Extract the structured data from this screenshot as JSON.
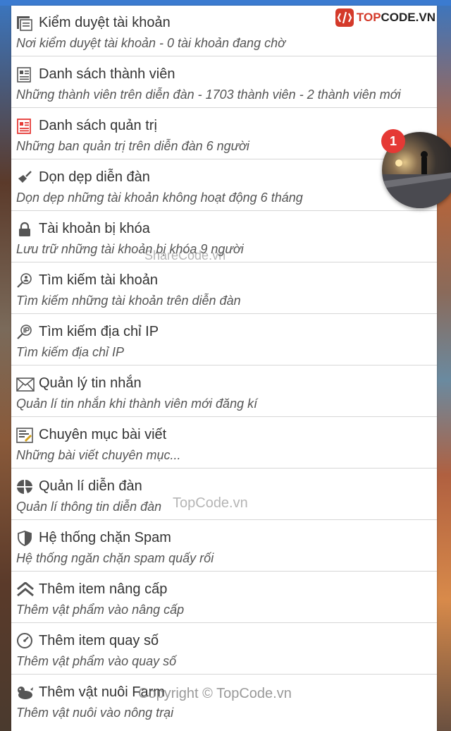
{
  "logo": {
    "prefix": "TOP",
    "suffix": "CODE.VN"
  },
  "notification": {
    "count": "1"
  },
  "items": [
    {
      "title": "Kiểm duyệt tài khoản",
      "desc": "Nơi kiểm duyệt tài khoản - 0 tài khoản đang chờ",
      "icon": "list-icon"
    },
    {
      "title": "Danh sách thành viên",
      "desc": "Những thành viên trên diễn đàn - 1703 thành viên - 2 thành viên mới",
      "icon": "document-icon"
    },
    {
      "title": "Danh sách quản trị",
      "desc": "Những ban quản trị trên diễn đàn 6 người",
      "icon": "admin-document-icon"
    },
    {
      "title": "Dọn dẹp diễn đàn",
      "desc": "Dọn dẹp những tài khoản không hoạt động 6 tháng",
      "icon": "broom-icon"
    },
    {
      "title": "Tài khoản bị khóa",
      "desc": "Lưu trữ những tài khoản bị khóa 9 người",
      "icon": "lock-icon"
    },
    {
      "title": "Tìm kiếm tài khoản",
      "desc": "Tìm kiếm những tài khoản trên diễn đàn",
      "icon": "search-user-icon"
    },
    {
      "title": "Tìm kiếm địa chỉ IP",
      "desc": "Tìm kiếm địa chỉ IP",
      "icon": "search-ip-icon"
    },
    {
      "title": "Quản lý tin nhắn",
      "desc": "Quản lí tin nhắn khi thành viên mới đăng kí",
      "icon": "envelope-icon"
    },
    {
      "title": "Chuyên mục bài viết",
      "desc": "Những bài viết chuyên mục...",
      "icon": "article-icon"
    },
    {
      "title": "Quản lí diễn đàn",
      "desc": "Quản lí thông tin diễn đàn",
      "icon": "pie-chart-icon"
    },
    {
      "title": "Hệ thống chặn Spam",
      "desc": "Hệ thống ngăn chặn spam quấy rối",
      "icon": "shield-icon"
    },
    {
      "title": "Thêm item nâng cấp",
      "desc": "Thêm vật phẩm vào nâng cấp",
      "icon": "double-chevron-up-icon"
    },
    {
      "title": "Thêm item quay số",
      "desc": "Thêm vật phẩm vào quay số",
      "icon": "dial-icon"
    },
    {
      "title": "Thêm vật nuôi Farm",
      "desc": "Thêm vật nuôi vào nông trại",
      "icon": "pet-icon"
    }
  ],
  "watermarks": {
    "sharecode": "ShareCode.vn",
    "topcode": "TopCode.vn",
    "copyright": "Copyright © TopCode.vn"
  }
}
